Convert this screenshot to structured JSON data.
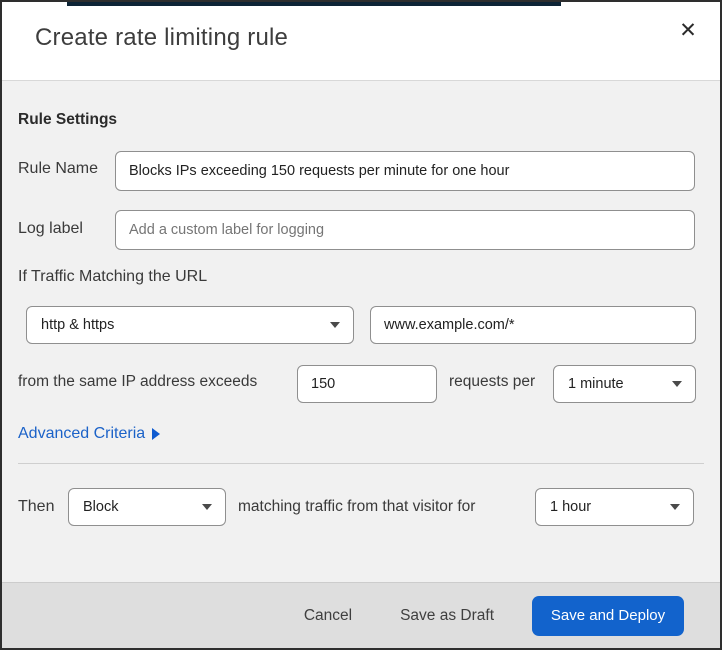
{
  "dialog": {
    "title": "Create rate limiting rule",
    "close_icon": "✕"
  },
  "form": {
    "section_heading": "Rule Settings",
    "rule_name": {
      "label": "Rule Name",
      "value": "Blocks IPs exceeding 150 requests per minute for one hour"
    },
    "log_label": {
      "label": "Log label",
      "placeholder": "Add a custom label for logging"
    },
    "traffic_match": {
      "heading": "If Traffic Matching the URL",
      "scheme_selected": "http & https",
      "url_value": "www.example.com/*",
      "threshold_prefix": "from the same IP address exceeds",
      "threshold_value": "150",
      "threshold_suffix": "requests per",
      "period_selected": "1 minute"
    },
    "advanced_criteria_label": "Advanced Criteria",
    "then_clause": {
      "label": "Then",
      "action_selected": "Block",
      "middle_text": "matching traffic from that visitor for",
      "duration_selected": "1 hour"
    }
  },
  "footer": {
    "cancel_label": "Cancel",
    "save_draft_label": "Save as Draft",
    "save_deploy_label": "Save and Deploy"
  },
  "colors": {
    "primary_button": "#1263cc",
    "link": "#1b62c8",
    "top_strip": "#0d2436"
  }
}
